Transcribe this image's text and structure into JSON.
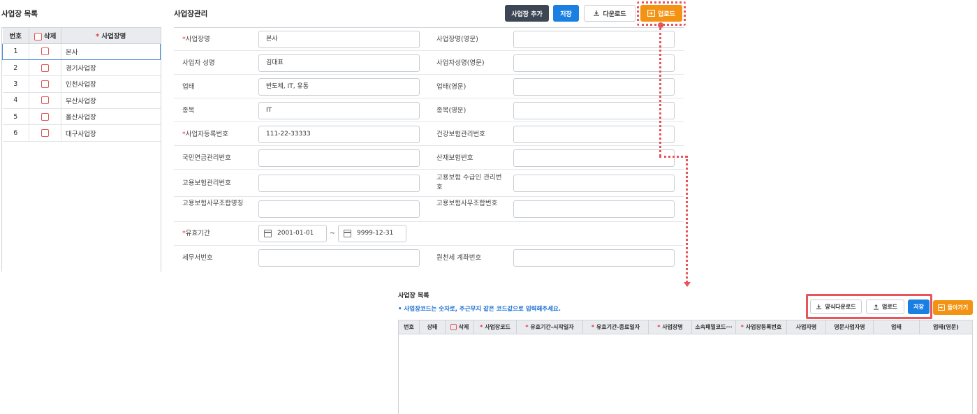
{
  "left": {
    "title": "사업장 목록",
    "headers": {
      "no": "번호",
      "delete": "삭제",
      "name": "사업장명"
    },
    "rows": [
      {
        "no": "1",
        "name": "본사"
      },
      {
        "no": "2",
        "name": "경기사업장"
      },
      {
        "no": "3",
        "name": "인천사업장"
      },
      {
        "no": "4",
        "name": "부산사업장"
      },
      {
        "no": "5",
        "name": "울산사업장"
      },
      {
        "no": "6",
        "name": "대구사업장"
      }
    ]
  },
  "form": {
    "title": "사업장관리",
    "buttons": {
      "add": "사업장 추가",
      "save": "저장",
      "download": "다운로드",
      "upload": "업로드"
    },
    "required_mark": "*",
    "fields": {
      "biz_name": {
        "label": "사업장명",
        "value": "본사"
      },
      "biz_name_en": {
        "label": "사업장명(영문)",
        "value": ""
      },
      "owner": {
        "label": "사업자 성명",
        "value": "김대표"
      },
      "owner_en": {
        "label": "사업자성명(영문)",
        "value": ""
      },
      "industry": {
        "label": "업태",
        "value": "반도체, IT, 유통"
      },
      "industry_en": {
        "label": "업태(영문)",
        "value": ""
      },
      "item": {
        "label": "종목",
        "value": "IT"
      },
      "item_en": {
        "label": "종목(영문)",
        "value": ""
      },
      "reg_no": {
        "label": "사업자등록번호",
        "value": "111-22-33333"
      },
      "health_no": {
        "label": "건강보험관리번호",
        "value": ""
      },
      "pension_no": {
        "label": "국민연금관리번호",
        "value": ""
      },
      "accident_no": {
        "label": "산재보험번호",
        "value": ""
      },
      "employ_no": {
        "label": "고용보험관리번호",
        "value": ""
      },
      "employ_recv_no": {
        "label": "고용보험 수급인 관리번호",
        "value": ""
      },
      "employ_office": {
        "label": "고용보험사무조합명칭",
        "value": ""
      },
      "employ_office_no": {
        "label": "고용보험사무조합번호",
        "value": ""
      },
      "valid_period": {
        "label": "유효기간",
        "start": "2001-01-01",
        "end": "9999-12-31",
        "sep": "~"
      },
      "tax_office": {
        "label": "세무서번호",
        "value": ""
      },
      "withholding": {
        "label": "원천세 계좌번호",
        "value": ""
      }
    }
  },
  "bottom": {
    "title": "사업장 목록",
    "note": "• 사업장코드는 숫자로, 주근무지 같은 코드값으로 입력해주세요.",
    "buttons": {
      "form_download": "양식다운로드",
      "upload": "업로드",
      "save": "저장",
      "back": "돌아가기"
    },
    "columns": [
      "번호",
      "상태",
      "삭제",
      "사업장코드",
      "유효기간-시작일자",
      "유효기간-종료일자",
      "사업장명",
      "소속패밀코드···",
      "사업장등록번호",
      "사업자명",
      "영문사업자명",
      "업태",
      "업태(영문)"
    ]
  },
  "colors": {
    "accent_red": "#e9535a",
    "blue": "#1a7fe3",
    "orange": "#f39313",
    "dark": "#3d4654"
  },
  "icons": [
    "download-icon",
    "upload-icon",
    "enter-icon",
    "calendar-icon",
    "checkbox-icon"
  ]
}
